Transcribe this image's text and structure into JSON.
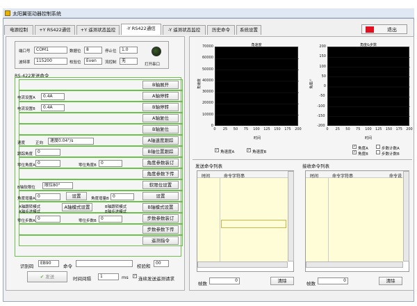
{
  "window": {
    "title": "太阳翼驱动器控制系统"
  },
  "tabs": [
    {
      "label": "电源控制"
    },
    {
      "label": "+Y RS422通信"
    },
    {
      "label": "+Y 遥测状态监控"
    },
    {
      "label": "-Y RS422通信"
    },
    {
      "label": "-Y 遥测状态监控"
    },
    {
      "label": "历史命令"
    },
    {
      "label": "系统设置"
    }
  ],
  "exit_label": "退出",
  "serial": {
    "port_label": "端口号",
    "port_value": "COM1",
    "baud_label": "波特率",
    "baud_value": "115200",
    "data_label": "数据位",
    "data_value": "8",
    "parity_label": "校验位",
    "parity_value": "Even",
    "stop_label": "停止位",
    "stop_value": "1.0",
    "flow_label": "流控制",
    "flow_value": "无",
    "open_label": "打开串口"
  },
  "rs422_title": "RS-422发送命令",
  "commands": [
    "B轴展开",
    "A轴停转",
    "B轴停转",
    "A轴复位",
    "B轴复位",
    "A轴速度跟踪",
    "B轴位置跟踪",
    "角度参数装订",
    "角度参数下传",
    "软限位设置",
    "设置",
    "B轴模式设置",
    "步数参数装订",
    "步数参数下传",
    "遥测指令"
  ],
  "params": {
    "currentA_label": "电流设置A",
    "currentA_value": "0.4A",
    "currentB_label": "电流设置B",
    "currentB_value": "0.4A",
    "speed_label": "速度",
    "speed_dir": "正向",
    "speed_value": "速度0.04°/s",
    "track_label": "跟踪角度",
    "track_value": "0",
    "posA_label": "零位角度A",
    "posA_value": "0",
    "posB_label": "零位角度B",
    "posB_value": "0",
    "limit_label": "B轴软限位",
    "limit_value": "限位80°",
    "angA_label": "角度增量A",
    "angA_value": "0",
    "angB_label": "角度增量B",
    "angB_value": "0",
    "set_label": "设置",
    "modeA1": "A轴跟转模式",
    "modeA2": "A轴步进模式",
    "modeA_btn": "A轴模式设置",
    "modeB1": "B轴跟转模式",
    "modeB2": "B轴步进模式",
    "stepA_label": "零位步数A",
    "stepA_value": "0",
    "stepB_label": "零位步数B",
    "stepB_value": "0"
  },
  "bottom": {
    "id_label": "识别码",
    "id_value": "EB90",
    "cmd_label": "命令",
    "cmd_value": "",
    "checksum_label": "校验和",
    "checksum_value": "00",
    "send_label": "发送",
    "interval_label": "时间间隔",
    "interval_value": "1",
    "interval_unit": "ms",
    "continuous_label": "连续发送遥测请求"
  },
  "plot1": {
    "title": "角速度",
    "xlabel": "时间",
    "ylabel": "角速度",
    "yticks": [
      "70000",
      "60000",
      "50000",
      "40000",
      "30000",
      "20000",
      "10000",
      "0"
    ],
    "xticks": [
      "0",
      "25",
      "50",
      "75",
      "100",
      "125",
      "150",
      "175",
      "200"
    ]
  },
  "plot2": {
    "title": "角度&步数",
    "xlabel": "时间",
    "ylabel": "角度/°",
    "yticks": [
      "200",
      "150",
      "100",
      "50",
      "0",
      "-50",
      "-100",
      "-150",
      "-200"
    ],
    "xticks": [
      "0",
      "25",
      "50",
      "75",
      "100",
      "125",
      "150",
      "175",
      "200"
    ]
  },
  "legend1": [
    {
      "label": "角速度A"
    },
    {
      "label": "角速度B"
    }
  ],
  "legend2": [
    {
      "label": "角度A"
    },
    {
      "label": "角度B"
    },
    {
      "label": "步数计数A"
    },
    {
      "label": "步数计数B"
    }
  ],
  "send_list": {
    "title": "发送命令列表",
    "col1": "时间",
    "col2": "命令字符串"
  },
  "recv_list": {
    "title": "接收命令列表",
    "col1": "时间",
    "col2": "命令字符串",
    "col3": "命令说"
  },
  "frames_label": "帧数",
  "frames_send": "0",
  "frames_recv": "0",
  "clear_label": "清除"
}
